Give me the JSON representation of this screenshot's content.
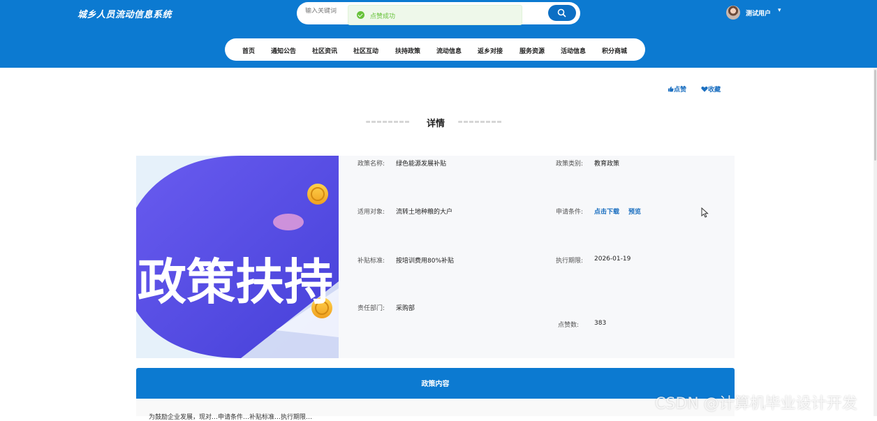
{
  "header": {
    "site_title": "城乡人员流动信息系统",
    "search_placeholder": "输入关键词",
    "user_name": "测试用户",
    "user_caret": "▾"
  },
  "toast": {
    "message": "点赞成功"
  },
  "nav": {
    "items": [
      "首页",
      "通知公告",
      "社区资讯",
      "社区互动",
      "扶持政策",
      "流动信息",
      "返乡对接",
      "服务资源",
      "活动信息",
      "积分商城"
    ]
  },
  "actions": {
    "like_label": "点赞",
    "favorite_label": "收藏"
  },
  "detail": {
    "section_title": "详情",
    "image_text": "政策扶持",
    "fields": {
      "policy_name_label": "政策名称:",
      "policy_name": "绿色能源发展补贴",
      "policy_type_label": "政策类别:",
      "policy_type": "教育政策",
      "target_label": "适用对象:",
      "target": "流转土地种粮的大户",
      "condition_label": "申请条件:",
      "download_link": "点击下载",
      "preview_link": "预览",
      "standard_label": "补贴标准:",
      "standard": "按培训费用80%补贴",
      "period_label": "执行期限:",
      "period": "2026-01-19",
      "dept_label": "责任部门:",
      "dept": "采购部",
      "likes_label": "点赞数:",
      "likes": "383"
    }
  },
  "content": {
    "title": "政策内容",
    "text": "为鼓励企业发展，现对…申请条件…补贴标准…执行期限…"
  },
  "watermark": "CSDN @计算机毕业设计开发",
  "colors": {
    "primary": "#0c7ad1",
    "success": "#67c23a",
    "link": "#1b6fc0"
  }
}
